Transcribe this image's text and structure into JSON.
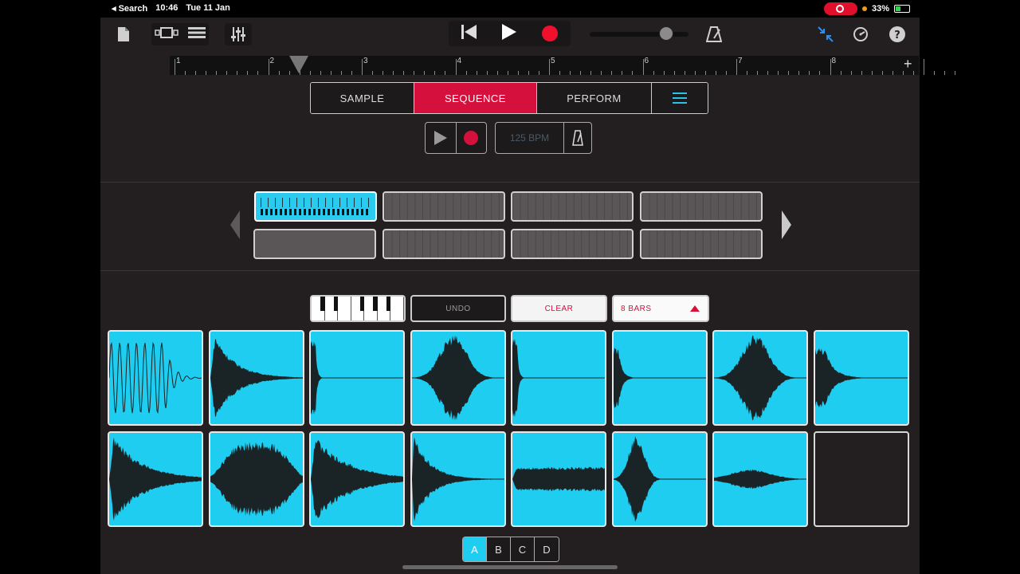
{
  "status": {
    "back_label": "◂ Search",
    "time": "10:46",
    "date": "Tue 11 Jan",
    "battery": "33%"
  },
  "ruler": {
    "numbers": [
      "1",
      "2",
      "3",
      "4",
      "5",
      "6",
      "7",
      "8"
    ],
    "add_label": "+"
  },
  "tabs": [
    {
      "label": "SAMPLE",
      "active": false
    },
    {
      "label": "SEQUENCE",
      "active": true
    },
    {
      "label": "PERFORM",
      "active": false
    }
  ],
  "sequencer": {
    "bpm": "125 BPM"
  },
  "controls": {
    "undo": "UNDO",
    "clear": "CLEAR",
    "bars": "8 BARS"
  },
  "bank": {
    "items": [
      "A",
      "B",
      "C",
      "D"
    ],
    "active": "A"
  },
  "colors": {
    "accent_red": "#d5103c",
    "pad_cyan": "#1ecdf0",
    "background": "#231f20"
  },
  "pads": [
    {
      "wave": "sine-decay"
    },
    {
      "wave": "hit-decay"
    },
    {
      "wave": "click"
    },
    {
      "wave": "swell"
    },
    {
      "wave": "click"
    },
    {
      "wave": "short-hit"
    },
    {
      "wave": "swell"
    },
    {
      "wave": "short-decay"
    },
    {
      "wave": "long-decay"
    },
    {
      "wave": "blob"
    },
    {
      "wave": "dense-decay"
    },
    {
      "wave": "smooth-decay"
    },
    {
      "wave": "sustain"
    },
    {
      "wave": "mid-hit"
    },
    {
      "wave": "soft-swell"
    },
    {
      "wave": "empty"
    }
  ]
}
